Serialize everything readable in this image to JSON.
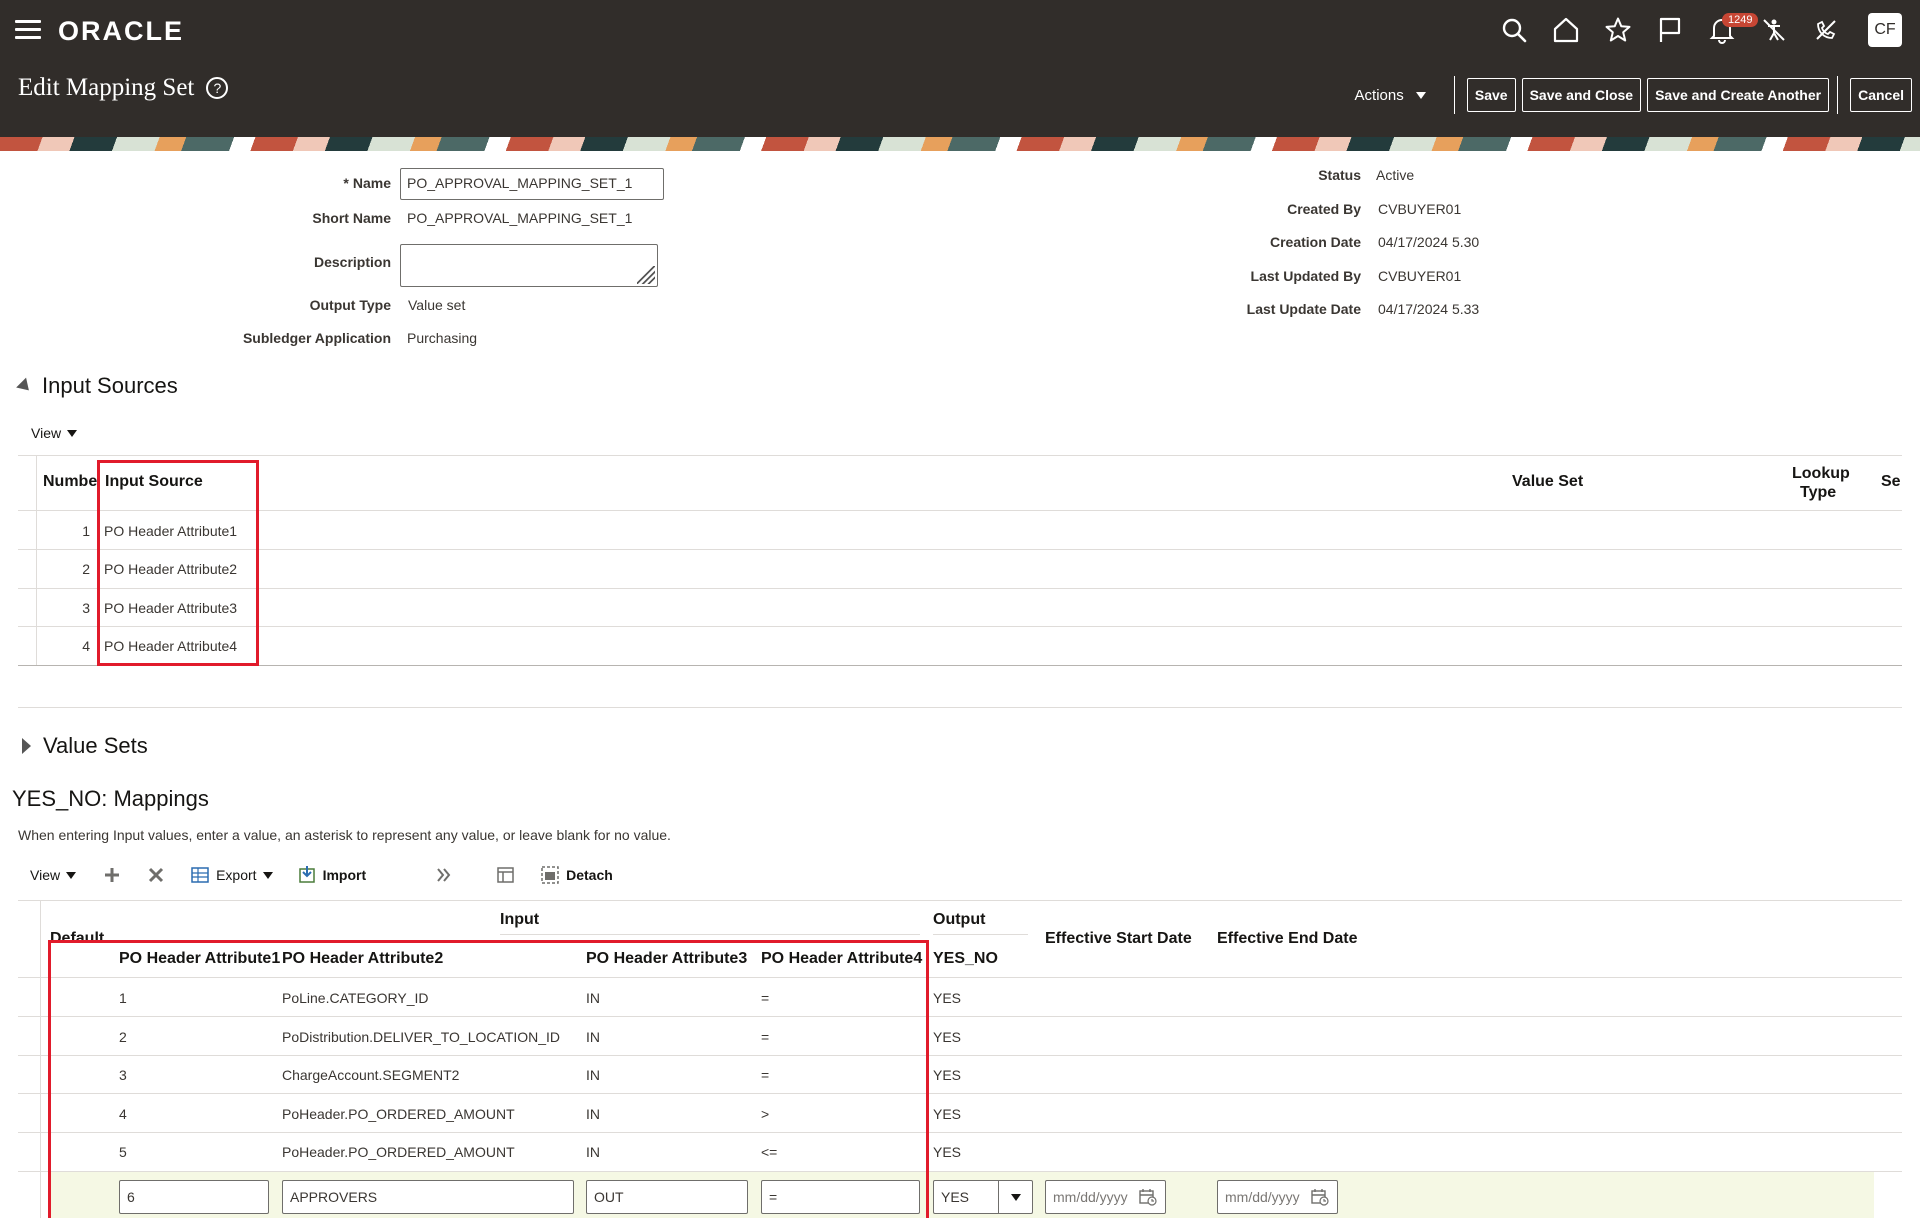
{
  "header": {
    "brand": "ORACLE",
    "page_title": "Edit Mapping Set",
    "notification_count": "1249",
    "avatar_initials": "CF",
    "actions_label": "Actions",
    "buttons": {
      "save": "Save",
      "save_close": "Save and Close",
      "save_create": "Save and Create Another",
      "cancel": "Cancel"
    }
  },
  "form": {
    "name_label": "Name",
    "name_value": "PO_APPROVAL_MAPPING_SET_1",
    "short_name_label": "Short Name",
    "short_name_value": "PO_APPROVAL_MAPPING_SET_1",
    "description_label": "Description",
    "description_value": "",
    "output_type_label": "Output Type",
    "output_type_value": "Value set",
    "subledger_label": "Subledger Application",
    "subledger_value": "Purchasing",
    "status_label": "Status",
    "status_value": "Active",
    "created_by_label": "Created By",
    "created_by_value": "CVBUYER01",
    "creation_date_label": "Creation Date",
    "creation_date_value": "04/17/2024 5.30",
    "last_updated_by_label": "Last Updated By",
    "last_updated_by_value": "CVBUYER01",
    "last_update_date_label": "Last Update Date",
    "last_update_date_value": "04/17/2024 5.33"
  },
  "input_sources": {
    "title": "Input Sources",
    "view_label": "View",
    "columns": {
      "number": "Numbe",
      "input_source": "Input Source",
      "value_set": "Value Set",
      "lookup_type_1": "Lookup",
      "lookup_type_2": "Type",
      "extra": "Se"
    },
    "rows": [
      {
        "number": "1",
        "source": "PO Header Attribute1"
      },
      {
        "number": "2",
        "source": "PO Header Attribute2"
      },
      {
        "number": "3",
        "source": "PO Header Attribute3"
      },
      {
        "number": "4",
        "source": "PO Header Attribute4"
      }
    ]
  },
  "value_sets": {
    "title": "Value Sets"
  },
  "mappings": {
    "title": "YES_NO: Mappings",
    "instructions": "When entering Input values, enter a value, an asterisk to represent any value, or leave blank for no value.",
    "toolbar": {
      "view": "View",
      "export": "Export",
      "import": "Import",
      "detach": "Detach"
    },
    "group_headers": {
      "input": "Input",
      "output": "Output",
      "default": "Default"
    },
    "columns": {
      "attr1": "PO Header Attribute1",
      "attr2": "PO Header Attribute2",
      "attr3": "PO Header Attribute3",
      "attr4": "PO Header Attribute4",
      "yes_no": "YES_NO",
      "start": "Effective Start Date",
      "end": "Effective End Date"
    },
    "rows": [
      {
        "a1": "1",
        "a2": "PoLine.CATEGORY_ID",
        "a3": "IN",
        "a4": "=",
        "out": "YES"
      },
      {
        "a1": "2",
        "a2": "PoDistribution.DELIVER_TO_LOCATION_ID",
        "a3": "IN",
        "a4": "=",
        "out": "YES"
      },
      {
        "a1": "3",
        "a2": "ChargeAccount.SEGMENT2",
        "a3": "IN",
        "a4": "=",
        "out": "YES"
      },
      {
        "a1": "4",
        "a2": "PoHeader.PO_ORDERED_AMOUNT",
        "a3": "IN",
        "a4": ">",
        "out": "YES"
      },
      {
        "a1": "5",
        "a2": "PoHeader.PO_ORDERED_AMOUNT",
        "a3": "IN",
        "a4": "<=",
        "out": "YES"
      }
    ],
    "edit_row": {
      "a1": "6",
      "a2": "APPROVERS",
      "a3": "OUT",
      "a4": "=",
      "out": "YES",
      "start_placeholder": "mm/dd/yyyy",
      "end_placeholder": "mm/dd/yyyy"
    }
  },
  "colors": {
    "header_bg": "#312d2a",
    "highlight_border": "#e11b2b",
    "badge": "#c74634",
    "edit_row_bg": "#f5f8e4"
  }
}
